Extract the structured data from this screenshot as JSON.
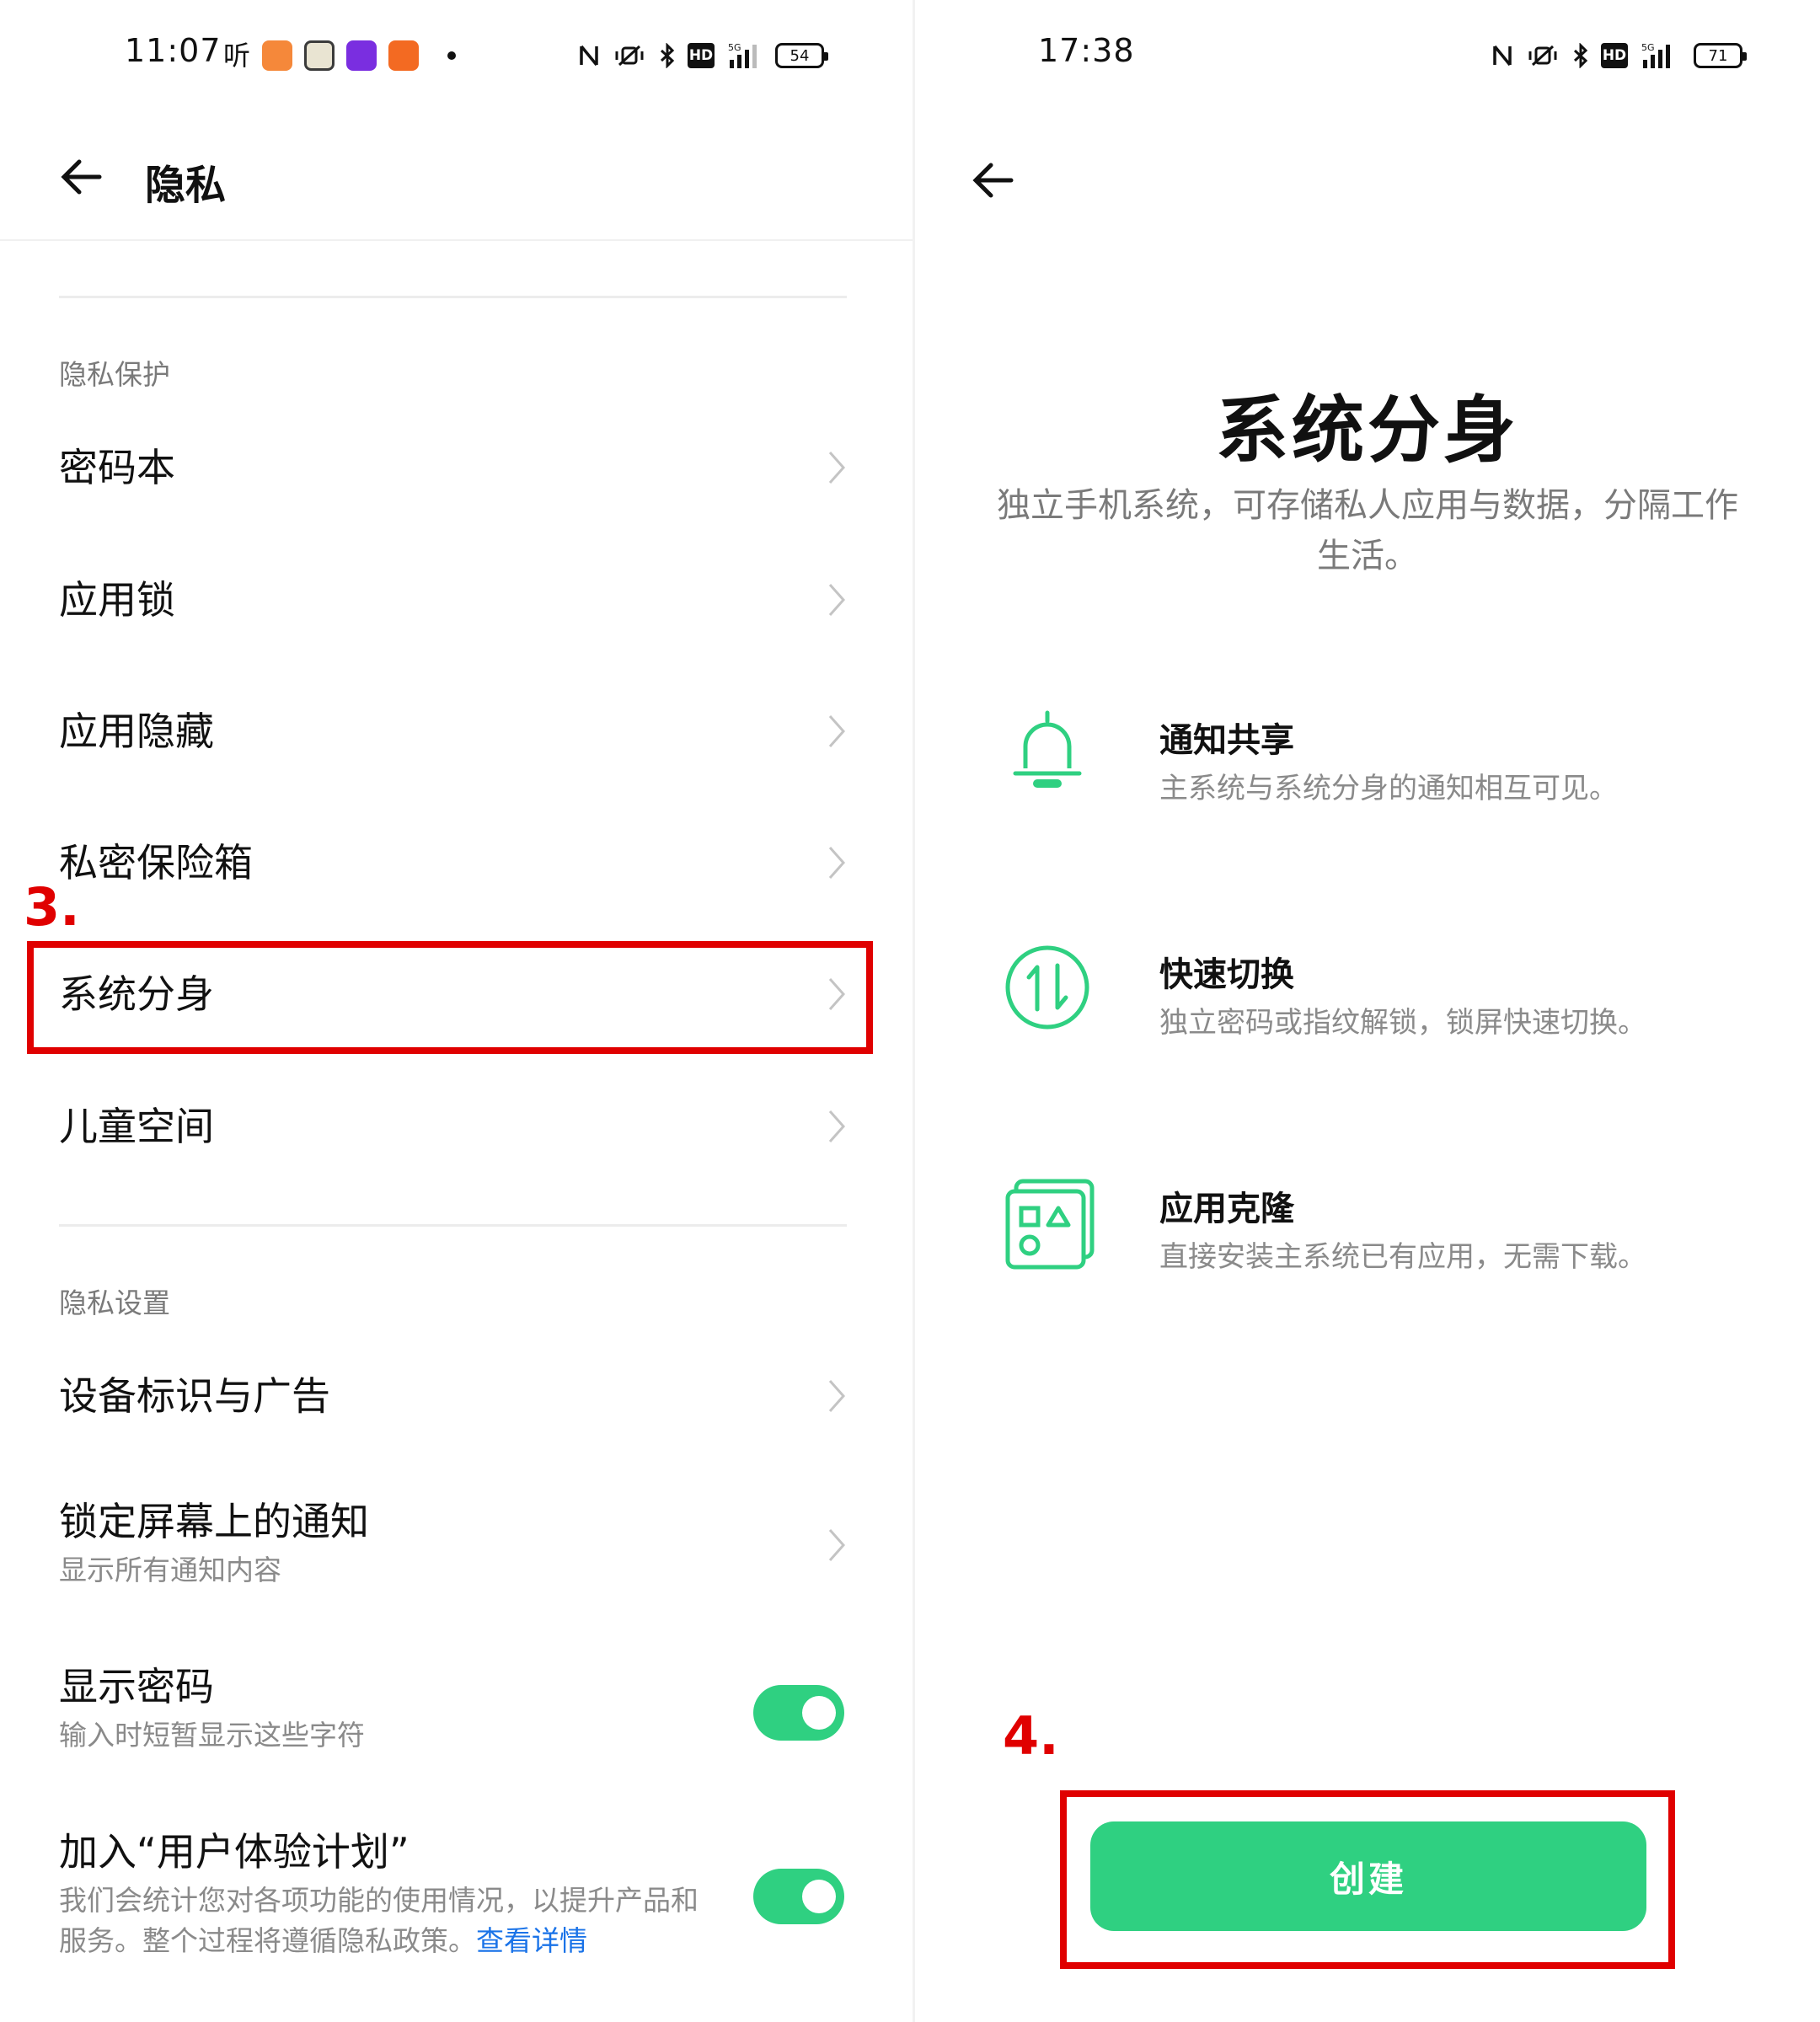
{
  "left": {
    "status": {
      "time": "11:07",
      "ting": "听",
      "battery": "54"
    },
    "header": {
      "title": "隐私"
    },
    "sections": [
      {
        "label": "隐私保护"
      },
      {
        "label": "隐私设置"
      }
    ],
    "items": [
      {
        "label": "密码本"
      },
      {
        "label": "应用锁"
      },
      {
        "label": "应用隐藏"
      },
      {
        "label": "私密保险箱"
      },
      {
        "label": "系统分身"
      },
      {
        "label": "儿童空间"
      },
      {
        "label": "设备标识与广告"
      },
      {
        "label": "锁定屏幕上的通知",
        "sub": "显示所有通知内容"
      },
      {
        "label": "显示密码",
        "sub": "输入时短暂显示这些字符",
        "toggle": "on"
      },
      {
        "label": "加入“用户体验计划”",
        "sub": "我们会统计您对各项功能的使用情况，以提升产品和服务。整个过程将遵循隐私政策。",
        "link": "查看详情",
        "toggle": "on"
      }
    ],
    "annotation": "3."
  },
  "right": {
    "status": {
      "time": "17:38",
      "battery": "71"
    },
    "hero": {
      "title": "系统分身",
      "subtitle": "独立手机系统，可存储私人应用与数据，分隔工作生活。"
    },
    "features": [
      {
        "title": "通知共享",
        "desc": "主系统与系统分身的通知相互可见。",
        "icon": "bell-icon"
      },
      {
        "title": "快速切换",
        "desc": "独立密码或指纹解锁，锁屏快速切换。",
        "icon": "switch-icon"
      },
      {
        "title": "应用克隆",
        "desc": "直接安装主系统已有应用，无需下载。",
        "icon": "app-clone-icon"
      }
    ],
    "create_label": "创建",
    "annotation": "4."
  },
  "colors": {
    "accent": "#2fd081",
    "link": "#1a73e8",
    "annotation": "#e00000"
  }
}
